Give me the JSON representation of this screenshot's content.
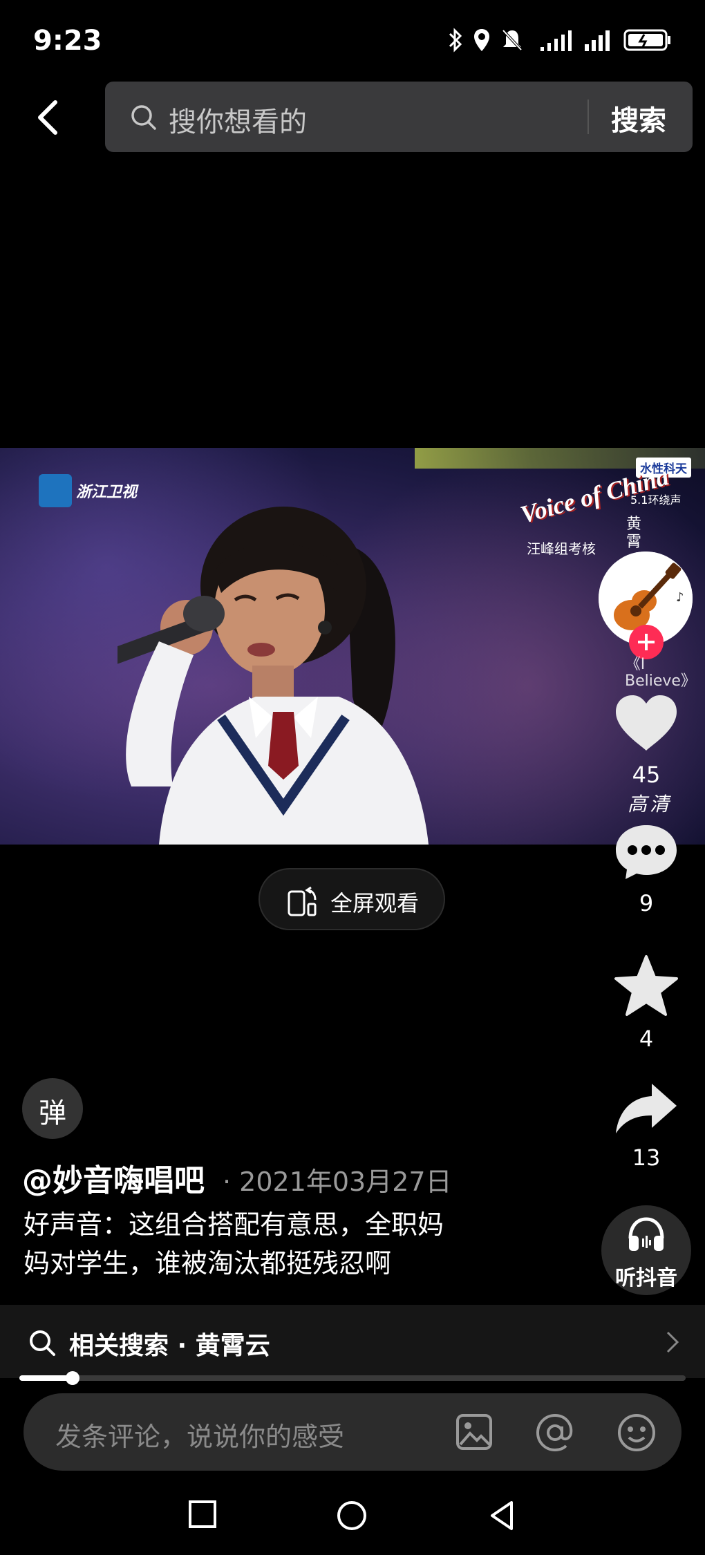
{
  "status_bar": {
    "time": "9:23"
  },
  "search": {
    "placeholder": "搜你想看的",
    "button_label": "搜索"
  },
  "video": {
    "channel_logo": "浙江卫视",
    "show_logo": "Voice of China",
    "show_logo_sub": "汪峰组考核",
    "surround_label": "5.1环绕声",
    "sponsor_tag": "水性科天",
    "vertical_title": "黄霄"
  },
  "fullscreen_label": "全屏观看",
  "rail": {
    "song_vertical": "《I Believe》",
    "likes": "45",
    "quality": "高清",
    "comments": "9",
    "favorites": "4",
    "shares": "13",
    "listen_label": "听抖音"
  },
  "post": {
    "danmaku_label": "弹",
    "author": "@妙音嗨唱吧",
    "date": "· 2021年03月27日",
    "caption_line1": "好声音：这组合搭配有意思，全职妈",
    "caption_line2": "妈对学生，谁被淘汰都挺残忍啊"
  },
  "related_search": "相关搜索 · 黄霄云",
  "progress": {
    "fraction": 0.08
  },
  "comment_input": {
    "placeholder": "发条评论，说说你的感受"
  },
  "colors": {
    "accent_red": "#fe2c55",
    "background": "#000000",
    "bar": "#2c2c2c"
  }
}
